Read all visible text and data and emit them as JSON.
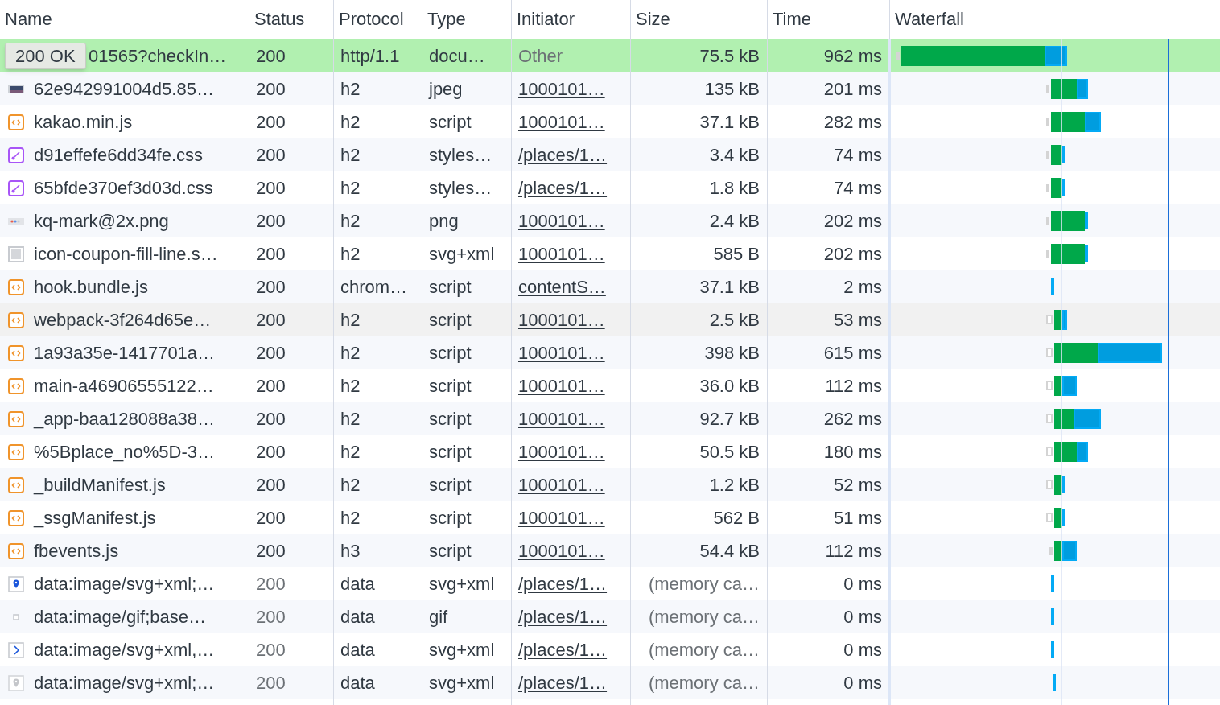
{
  "columns": [
    "Name",
    "Status",
    "Protocol",
    "Type",
    "Initiator",
    "Size",
    "Time",
    "Waterfall"
  ],
  "rows": [
    {
      "kind": "none",
      "name": "01565?checkIn…",
      "tooltip": "200 OK",
      "status": "200",
      "protocol": "http/1.1",
      "type": "docu…",
      "initiator": "Other",
      "initiator_link": false,
      "size": "75.5 kB",
      "time": "962 ms",
      "from_cache": false,
      "selected": true,
      "hovered": false
    },
    {
      "kind": "photo",
      "name": "62e942991004d5.85…",
      "status": "200",
      "protocol": "h2",
      "type": "jpeg",
      "initiator": "1000101…",
      "initiator_link": true,
      "size": "135 kB",
      "time": "201 ms",
      "from_cache": false,
      "selected": false,
      "hovered": false
    },
    {
      "kind": "script",
      "name": "kakao.min.js",
      "status": "200",
      "protocol": "h2",
      "type": "script",
      "initiator": "1000101…",
      "initiator_link": true,
      "size": "37.1 kB",
      "time": "282 ms",
      "from_cache": false,
      "selected": false,
      "hovered": false
    },
    {
      "kind": "stylesheet",
      "name": "d91effefe6dd34fe.css",
      "status": "200",
      "protocol": "h2",
      "type": "styles…",
      "initiator": "/places/1…",
      "initiator_link": true,
      "size": "3.4 kB",
      "time": "74 ms",
      "from_cache": false,
      "selected": false,
      "hovered": false
    },
    {
      "kind": "stylesheet",
      "name": "65bfde370ef3d03d.css",
      "status": "200",
      "protocol": "h2",
      "type": "styles…",
      "initiator": "/places/1…",
      "initiator_link": true,
      "size": "1.8 kB",
      "time": "74 ms",
      "from_cache": false,
      "selected": false,
      "hovered": false
    },
    {
      "kind": "png",
      "name": "kq-mark@2x.png",
      "status": "200",
      "protocol": "h2",
      "type": "png",
      "initiator": "1000101…",
      "initiator_link": true,
      "size": "2.4 kB",
      "time": "202 ms",
      "from_cache": false,
      "selected": false,
      "hovered": false
    },
    {
      "kind": "svgfile",
      "name": "icon-coupon-fill-line.s…",
      "status": "200",
      "protocol": "h2",
      "type": "svg+xml",
      "initiator": "1000101…",
      "initiator_link": true,
      "size": "585 B",
      "time": "202 ms",
      "from_cache": false,
      "selected": false,
      "hovered": false
    },
    {
      "kind": "script",
      "name": "hook.bundle.js",
      "status": "200",
      "protocol": "chrom…",
      "type": "script",
      "initiator": "contentS…",
      "initiator_link": true,
      "size": "37.1 kB",
      "time": "2 ms",
      "from_cache": false,
      "selected": false,
      "hovered": false
    },
    {
      "kind": "script",
      "name": "webpack-3f264d65e…",
      "status": "200",
      "protocol": "h2",
      "type": "script",
      "initiator": "1000101…",
      "initiator_link": true,
      "size": "2.5 kB",
      "time": "53 ms",
      "from_cache": false,
      "selected": false,
      "hovered": true
    },
    {
      "kind": "script",
      "name": "1a93a35e-1417701a…",
      "status": "200",
      "protocol": "h2",
      "type": "script",
      "initiator": "1000101…",
      "initiator_link": true,
      "size": "398 kB",
      "time": "615 ms",
      "from_cache": false,
      "selected": false,
      "hovered": false
    },
    {
      "kind": "script",
      "name": "main-a46906555122…",
      "status": "200",
      "protocol": "h2",
      "type": "script",
      "initiator": "1000101…",
      "initiator_link": true,
      "size": "36.0 kB",
      "time": "112 ms",
      "from_cache": false,
      "selected": false,
      "hovered": false
    },
    {
      "kind": "script",
      "name": "_app-baa128088a38…",
      "status": "200",
      "protocol": "h2",
      "type": "script",
      "initiator": "1000101…",
      "initiator_link": true,
      "size": "92.7 kB",
      "time": "262 ms",
      "from_cache": false,
      "selected": false,
      "hovered": false
    },
    {
      "kind": "script",
      "name": "%5Bplace_no%5D-3…",
      "status": "200",
      "protocol": "h2",
      "type": "script",
      "initiator": "1000101…",
      "initiator_link": true,
      "size": "50.5 kB",
      "time": "180 ms",
      "from_cache": false,
      "selected": false,
      "hovered": false
    },
    {
      "kind": "script",
      "name": "_buildManifest.js",
      "status": "200",
      "protocol": "h2",
      "type": "script",
      "initiator": "1000101…",
      "initiator_link": true,
      "size": "1.2 kB",
      "time": "52 ms",
      "from_cache": false,
      "selected": false,
      "hovered": false
    },
    {
      "kind": "script",
      "name": "_ssgManifest.js",
      "status": "200",
      "protocol": "h2",
      "type": "script",
      "initiator": "1000101…",
      "initiator_link": true,
      "size": "562 B",
      "time": "51 ms",
      "from_cache": false,
      "selected": false,
      "hovered": false
    },
    {
      "kind": "script",
      "name": "fbevents.js",
      "status": "200",
      "protocol": "h3",
      "type": "script",
      "initiator": "1000101…",
      "initiator_link": true,
      "size": "54.4 kB",
      "time": "112 ms",
      "from_cache": false,
      "selected": false,
      "hovered": false
    },
    {
      "kind": "pin",
      "name": "data:image/svg+xml;…",
      "status": "200",
      "protocol": "data",
      "type": "svg+xml",
      "initiator": "/places/1…",
      "initiator_link": true,
      "size": "(memory ca…",
      "time": "0 ms",
      "from_cache": true,
      "selected": false,
      "hovered": false
    },
    {
      "kind": "gif",
      "name": "data:image/gif;base…",
      "status": "200",
      "protocol": "data",
      "type": "gif",
      "initiator": "/places/1…",
      "initiator_link": true,
      "size": "(memory ca…",
      "time": "0 ms",
      "from_cache": true,
      "selected": false,
      "hovered": false
    },
    {
      "kind": "chevron",
      "name": "data:image/svg+xml,…",
      "status": "200",
      "protocol": "data",
      "type": "svg+xml",
      "initiator": "/places/1…",
      "initiator_link": true,
      "size": "(memory ca…",
      "time": "0 ms",
      "from_cache": true,
      "selected": false,
      "hovered": false
    },
    {
      "kind": "pin-grey",
      "name": "data:image/svg+xml;…",
      "status": "200",
      "protocol": "data",
      "type": "svg+xml",
      "initiator": "/places/1…",
      "initiator_link": true,
      "size": "(memory ca…",
      "time": "0 ms",
      "from_cache": true,
      "selected": false,
      "hovered": false
    }
  ]
}
